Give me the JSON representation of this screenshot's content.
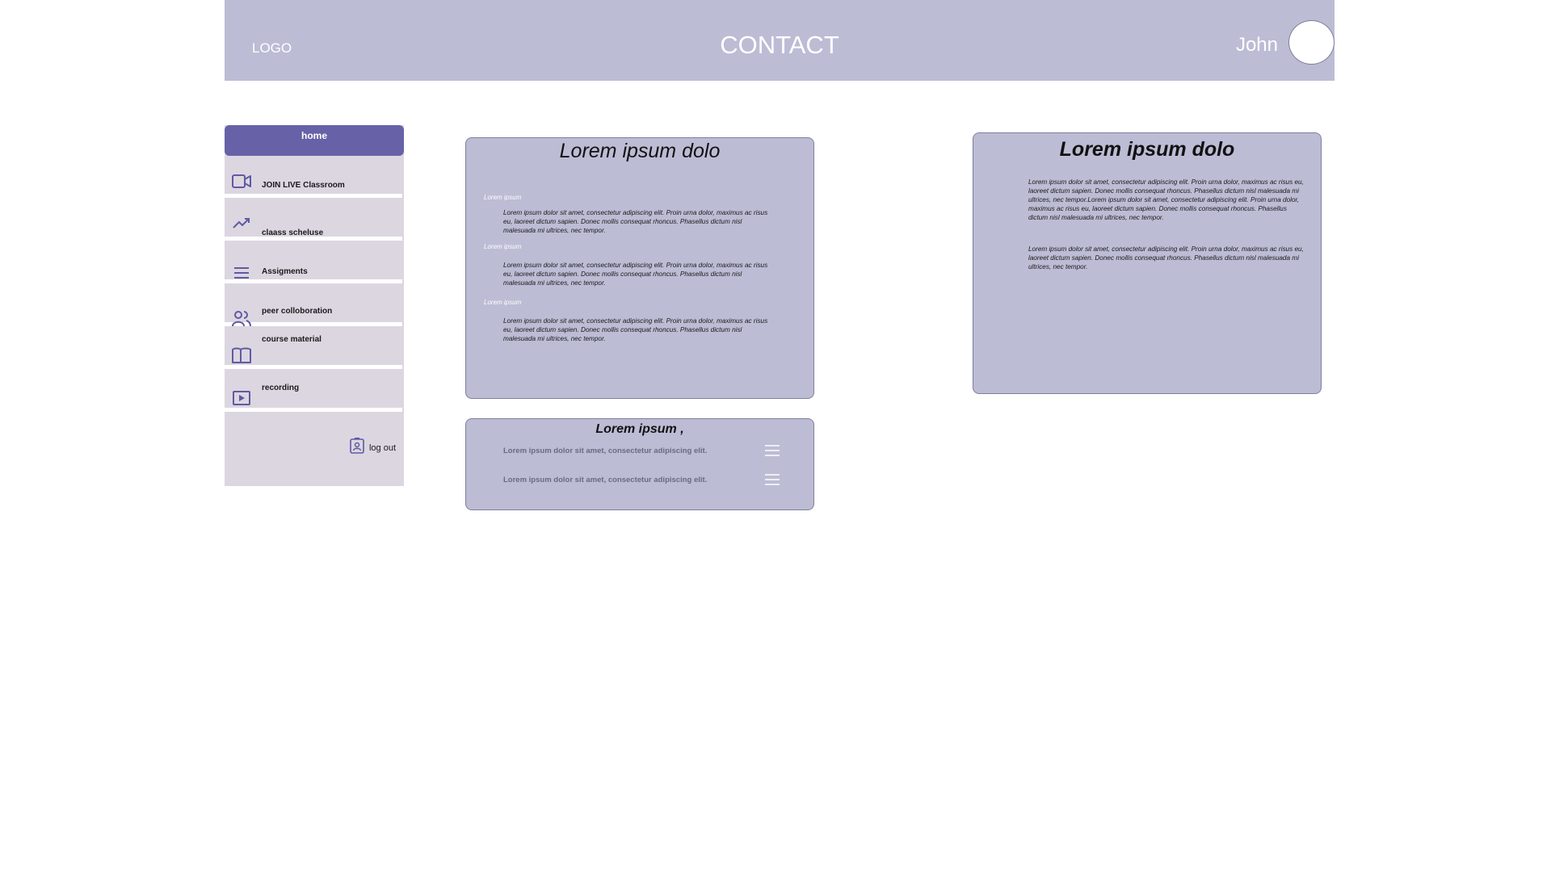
{
  "header": {
    "logo": "LOGO",
    "title": "CONTACT",
    "username": "John"
  },
  "sidebar": {
    "home": "home",
    "items": [
      {
        "label": "JOIN LIVE Classroom",
        "icon": "video-camera-icon"
      },
      {
        "label": "claass scheluse",
        "icon": "trending-up-icon"
      },
      {
        "label": "Assigments",
        "icon": "list-icon"
      },
      {
        "label": "peer colloboration",
        "icon": "people-icon"
      },
      {
        "label": "course material",
        "icon": "book-icon"
      },
      {
        "label": "recording",
        "icon": "play-icon"
      }
    ],
    "logout": "log out",
    "logout_icon": "badge-icon"
  },
  "card_left": {
    "title": "Lorem ipsum dolo",
    "sections": [
      {
        "subtitle": "Lorem ipsum",
        "text": "Lorem ipsum dolor sit amet, consectetur adipiscing elit. Proin urna dolor, maximus ac risus eu, laoreet dictum sapien. Donec mollis consequat rhoncus. Phasellus dictum nisl malesuada mi ultrices, nec tempor."
      },
      {
        "subtitle": "Lorem ipsum",
        "text": "Lorem ipsum dolor sit amet, consectetur adipiscing elit. Proin urna dolor, maximus ac risus eu, laoreet dictum sapien. Donec mollis consequat rhoncus. Phasellus dictum nisl malesuada mi ultrices, nec tempor."
      },
      {
        "subtitle": "Lorem ipsum",
        "text": "Lorem ipsum dolor sit amet, consectetur adipiscing elit. Proin urna dolor, maximus ac risus eu, laoreet dictum sapien. Donec mollis consequat rhoncus. Phasellus dictum nisl malesuada mi ultrices, nec tempor."
      }
    ]
  },
  "card_list": {
    "title": "Lorem ipsum ,",
    "rows": [
      {
        "text": "Lorem ipsum dolor sit amet, consectetur adipiscing elit."
      },
      {
        "text": "Lorem ipsum dolor sit amet, consectetur adipiscing elit."
      }
    ]
  },
  "card_right": {
    "title": "Lorem ipsum dolo",
    "paragraphs": [
      "Lorem ipsum dolor sit amet, consectetur adipiscing elit. Proin urna dolor, maximus ac risus eu, laoreet dictum sapien. Donec mollis consequat rhoncus. Phasellus dictum nisl malesuada mi ultrices, nec tempor.Lorem ipsum dolor sit amet, consectetur adipiscing elit. Proin urna dolor, maximus ac risus eu, laoreet dictum sapien. Donec mollis consequat rhoncus. Phasellus dictum nisl malesuada mi ultrices, nec tempor.",
      "Lorem ipsum dolor sit amet, consectetur adipiscing elit. Proin urna dolor, maximus ac risus eu, laoreet dictum sapien. Donec mollis consequat rhoncus. Phasellus dictum nisl malesuada mi ultrices, nec tempor."
    ]
  },
  "colors": {
    "header_bg": "#bcbcd5",
    "accent": "#6761a7",
    "sidebar_bg": "#dcd6e1",
    "card_bg": "#bcbcd5"
  }
}
